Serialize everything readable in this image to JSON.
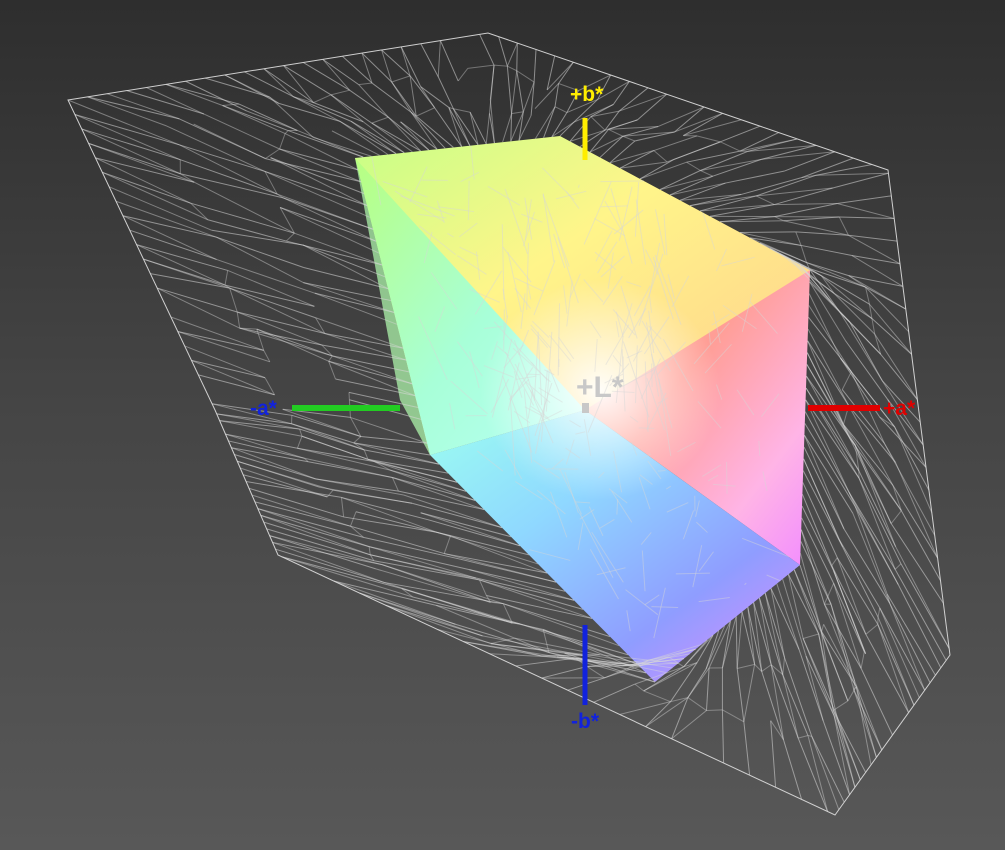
{
  "viewer": {
    "axis_labels": {
      "plus_b": "+b*",
      "minus_b": "-b*",
      "plus_a": "+a*",
      "minus_a": "-a*",
      "plus_l": "+L*"
    },
    "colors": {
      "background_top": "#2e2e2e",
      "background_bottom": "#585858",
      "axis_b_plus": "#ffee00",
      "axis_b_minus": "#1122dd",
      "axis_a_plus": "#e00000",
      "axis_a_minus": "#22cc22",
      "axis_l": "#c8c8c8",
      "wireframe": "#d8d8d8"
    },
    "solid_gamut": {
      "face_colors": {
        "yellow": "#fff27a",
        "green": "#b6ff7c",
        "cyan": "#9ffff2",
        "red": "#ff8a7a",
        "magenta": "#f47cff",
        "blue": "#6f8bff",
        "white": "#ffffff"
      }
    }
  }
}
